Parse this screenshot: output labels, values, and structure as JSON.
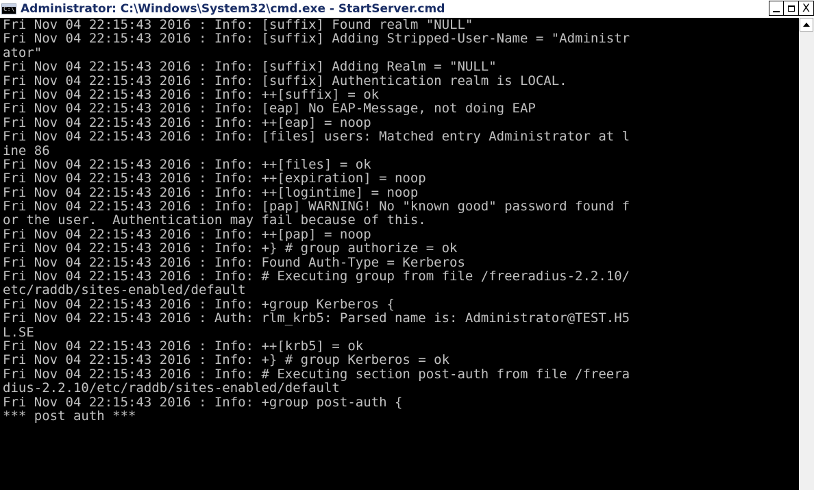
{
  "window": {
    "title": "Administrator: C:\\Windows\\System32\\cmd.exe - StartServer.cmd",
    "app_icon_text": "C:\\",
    "controls": {
      "minimize": "_",
      "maximize": "□",
      "close": "X"
    }
  },
  "console": {
    "lines": [
      "Fri Nov 04 22:15:43 2016 : Info: [suffix] Found realm \"NULL\"",
      "Fri Nov 04 22:15:43 2016 : Info: [suffix] Adding Stripped-User-Name = \"Administr",
      "ator\"",
      "Fri Nov 04 22:15:43 2016 : Info: [suffix] Adding Realm = \"NULL\"",
      "Fri Nov 04 22:15:43 2016 : Info: [suffix] Authentication realm is LOCAL.",
      "Fri Nov 04 22:15:43 2016 : Info: ++[suffix] = ok",
      "Fri Nov 04 22:15:43 2016 : Info: [eap] No EAP-Message, not doing EAP",
      "Fri Nov 04 22:15:43 2016 : Info: ++[eap] = noop",
      "Fri Nov 04 22:15:43 2016 : Info: [files] users: Matched entry Administrator at l",
      "ine 86",
      "Fri Nov 04 22:15:43 2016 : Info: ++[files] = ok",
      "Fri Nov 04 22:15:43 2016 : Info: ++[expiration] = noop",
      "Fri Nov 04 22:15:43 2016 : Info: ++[logintime] = noop",
      "Fri Nov 04 22:15:43 2016 : Info: [pap] WARNING! No \"known good\" password found f",
      "or the user.  Authentication may fail because of this.",
      "Fri Nov 04 22:15:43 2016 : Info: ++[pap] = noop",
      "Fri Nov 04 22:15:43 2016 : Info: +} # group authorize = ok",
      "Fri Nov 04 22:15:43 2016 : Info: Found Auth-Type = Kerberos",
      "Fri Nov 04 22:15:43 2016 : Info: # Executing group from file /freeradius-2.2.10/",
      "etc/raddb/sites-enabled/default",
      "Fri Nov 04 22:15:43 2016 : Info: +group Kerberos {",
      "Fri Nov 04 22:15:43 2016 : Auth: rlm_krb5: Parsed name is: Administrator@TEST.H5",
      "L.SE",
      "Fri Nov 04 22:15:43 2016 : Info: ++[krb5] = ok",
      "Fri Nov 04 22:15:43 2016 : Info: +} # group Kerberos = ok",
      "Fri Nov 04 22:15:43 2016 : Info: # Executing section post-auth from file /freera",
      "dius-2.2.10/etc/raddb/sites-enabled/default",
      "Fri Nov 04 22:15:43 2016 : Info: +group post-auth {",
      "*** post auth ***"
    ]
  },
  "colors": {
    "console_bg": "#000000",
    "console_text": "#c0c0c0",
    "title_text": "#1a2e66"
  }
}
